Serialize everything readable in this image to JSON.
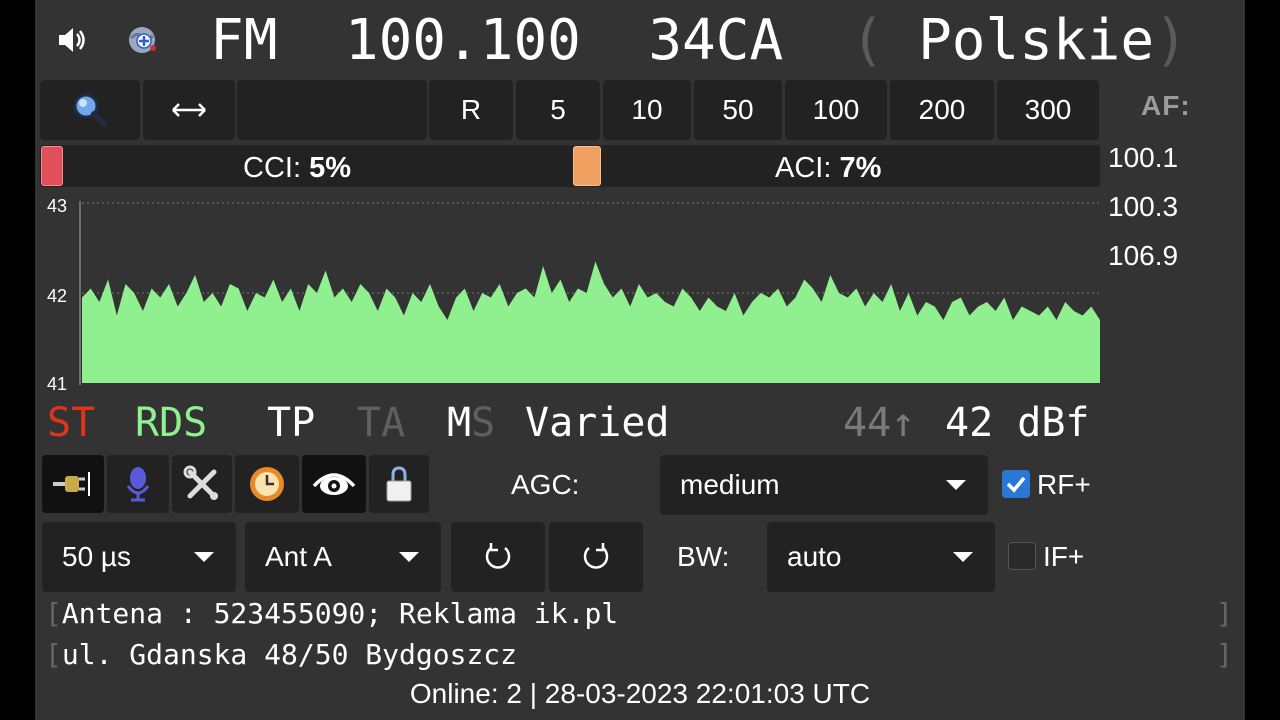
{
  "header": {
    "band": "FM",
    "frequency": "100.100",
    "pi": "34CA",
    "open_paren": "(",
    "close_paren": ")",
    "ps": "Polskie"
  },
  "toolbar": {
    "buttons": [
      "R",
      "5",
      "10",
      "50",
      "100",
      "200",
      "300"
    ]
  },
  "af": {
    "label": "AF:",
    "values": [
      "100.1",
      "100.3",
      "106.9"
    ]
  },
  "interference": {
    "cci_label": "CCI:",
    "cci_value": "5%",
    "aci_label": "ACI:",
    "aci_value": "7%",
    "cci_color": "#e0505a",
    "aci_color": "#f0a060"
  },
  "chart_data": {
    "type": "area",
    "ylim": [
      41,
      43
    ],
    "yticks": [
      "43",
      "42",
      "41"
    ],
    "fill_color": "#90f08f",
    "values": [
      41.95,
      42.05,
      41.9,
      42.15,
      41.75,
      42.1,
      42.0,
      41.8,
      42.05,
      41.95,
      42.1,
      41.85,
      42.0,
      42.2,
      41.9,
      42.0,
      41.85,
      42.1,
      42.05,
      41.8,
      42.0,
      41.95,
      42.15,
      41.9,
      42.05,
      41.8,
      42.1,
      42.0,
      42.25,
      41.95,
      42.05,
      41.9,
      42.1,
      42.0,
      41.8,
      42.05,
      41.95,
      41.75,
      42.0,
      41.9,
      42.1,
      41.85,
      41.7,
      41.95,
      42.05,
      41.8,
      42.0,
      41.95,
      42.1,
      41.85,
      42.0,
      42.05,
      41.95,
      42.3,
      42.0,
      42.15,
      41.9,
      42.05,
      42.0,
      42.35,
      42.1,
      41.95,
      42.05,
      41.85,
      42.1,
      41.95,
      42.0,
      41.9,
      41.85,
      42.05,
      41.95,
      41.8,
      41.95,
      41.85,
      41.8,
      42.0,
      41.75,
      41.9,
      42.0,
      41.95,
      42.05,
      41.85,
      41.95,
      42.15,
      42.05,
      41.9,
      42.2,
      42.0,
      41.95,
      42.05,
      41.85,
      42.0,
      41.9,
      42.1,
      41.8,
      42.0,
      41.75,
      41.9,
      41.85,
      41.7,
      41.9,
      41.95,
      41.75,
      41.85,
      41.9,
      41.8,
      41.95,
      41.7,
      41.85,
      41.8,
      41.75,
      41.85,
      41.7,
      41.9,
      41.8,
      41.75,
      41.85,
      41.7
    ]
  },
  "status": {
    "st": "ST",
    "rds": "RDS",
    "tp": "TP",
    "ta": "TA",
    "m": "M",
    "s": "S",
    "pty": "Varied",
    "peak": "44↑",
    "signal": "42 dBf",
    "st_color": "#e0341e",
    "rds_color": "#90f08f"
  },
  "controls": {
    "agc_label": "AGC:",
    "agc_value": "medium",
    "rf_label": "RF+",
    "rf_checked": true,
    "deemphasis_value": "50 µs",
    "antenna_value": "Ant A",
    "bw_label": "BW:",
    "bw_value": "auto",
    "if_label": "IF+",
    "if_checked": false
  },
  "radiotext": {
    "line1": "Antena : 523455090; Reklama ik.pl",
    "line2": "ul. Gdanska 48/50 Bydgoszcz",
    "open_bracket": "[",
    "close_bracket": "]"
  },
  "footer": {
    "text": "Online: 2  |  28-03-2023 22:01:03 UTC"
  },
  "icons": {
    "volume": "volume-icon",
    "add_server": "globe-plus-icon",
    "search": "search-icon",
    "resize": "horizontal-arrows-icon",
    "plug": "plug-icon",
    "mic": "microphone-icon",
    "tools": "tools-icon",
    "clock": "clock-icon",
    "eye": "eye-icon",
    "lock": "lock-icon",
    "rotate_ccw": "rotate-ccw-icon",
    "rotate_cw": "rotate-cw-icon"
  }
}
